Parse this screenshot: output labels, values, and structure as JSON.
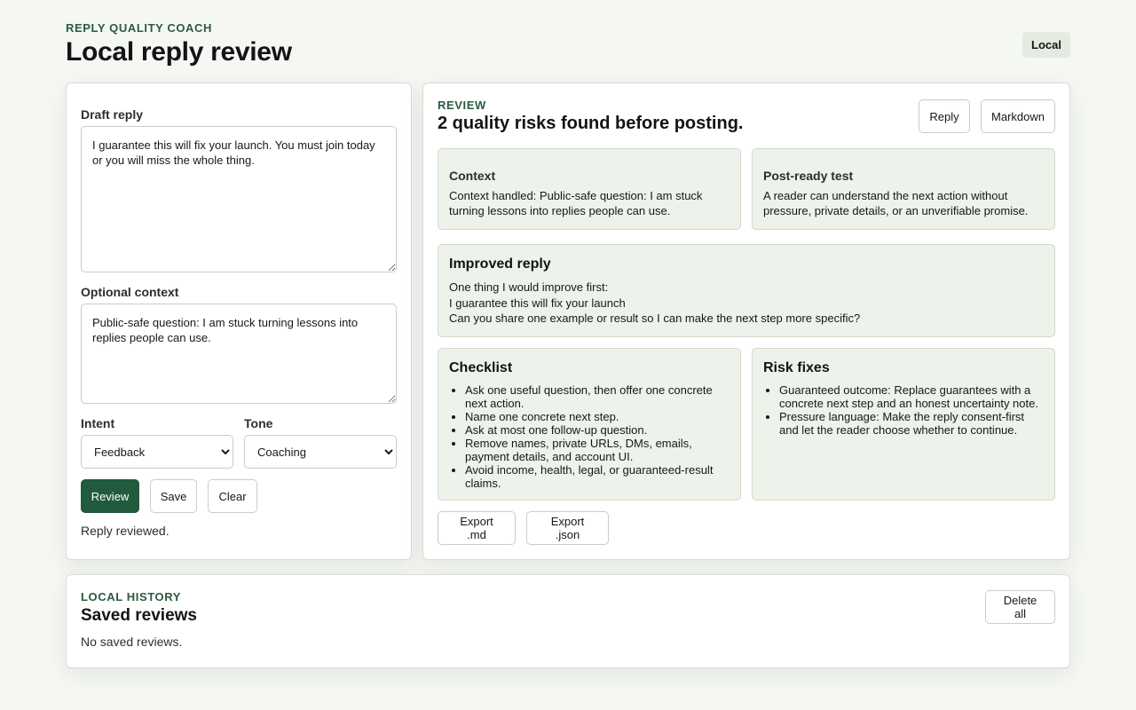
{
  "header": {
    "eyebrow": "REPLY QUALITY COACH",
    "title": "Local reply review",
    "badge": "Local"
  },
  "form": {
    "draft_label": "Draft reply",
    "draft_value": "I guarantee this will fix your launch. You must join today or you will miss the whole thing.",
    "context_label": "Optional context",
    "context_value": "Public-safe question: I am stuck turning lessons into replies people can use.",
    "intent_label": "Intent",
    "intent_value": "Feedback",
    "tone_label": "Tone",
    "tone_value": "Coaching",
    "review_button": "Review",
    "save_button": "Save",
    "clear_button": "Clear",
    "status": "Reply reviewed."
  },
  "review": {
    "eyebrow": "REVIEW",
    "title": "2 quality risks found before posting.",
    "reply_button": "Reply",
    "markdown_button": "Markdown",
    "context_card": {
      "title": "Context",
      "text": "Context handled: Public-safe question: I am stuck turning lessons into replies people can use."
    },
    "post_ready_card": {
      "title": "Post-ready test",
      "text": "A reader can understand the next action without pressure, private details, or an unverifiable promise."
    },
    "improved_card": {
      "title": "Improved reply",
      "lines": [
        "One thing I would improve first:",
        "I guarantee this will fix your launch",
        "Can you share one example or result so I can make the next step more specific?"
      ]
    },
    "checklist_card": {
      "title": "Checklist",
      "items": [
        "Ask one useful question, then offer one concrete next action.",
        "Name one concrete next step.",
        "Ask at most one follow-up question.",
        "Remove names, private URLs, DMs, emails, payment details, and account UI.",
        "Avoid income, health, legal, or guaranteed-result claims."
      ]
    },
    "risk_card": {
      "title": "Risk fixes",
      "items": [
        "Guaranteed outcome: Replace guarantees with a concrete next step and an honest uncertainty note.",
        "Pressure language: Make the reply consent-first and let the reader choose whether to continue."
      ]
    },
    "export_md_button": "Export .md",
    "export_json_button": "Export .json"
  },
  "history": {
    "eyebrow": "LOCAL HISTORY",
    "title": "Saved reviews",
    "empty_text": "No saved reviews.",
    "delete_all_button": "Delete all"
  }
}
